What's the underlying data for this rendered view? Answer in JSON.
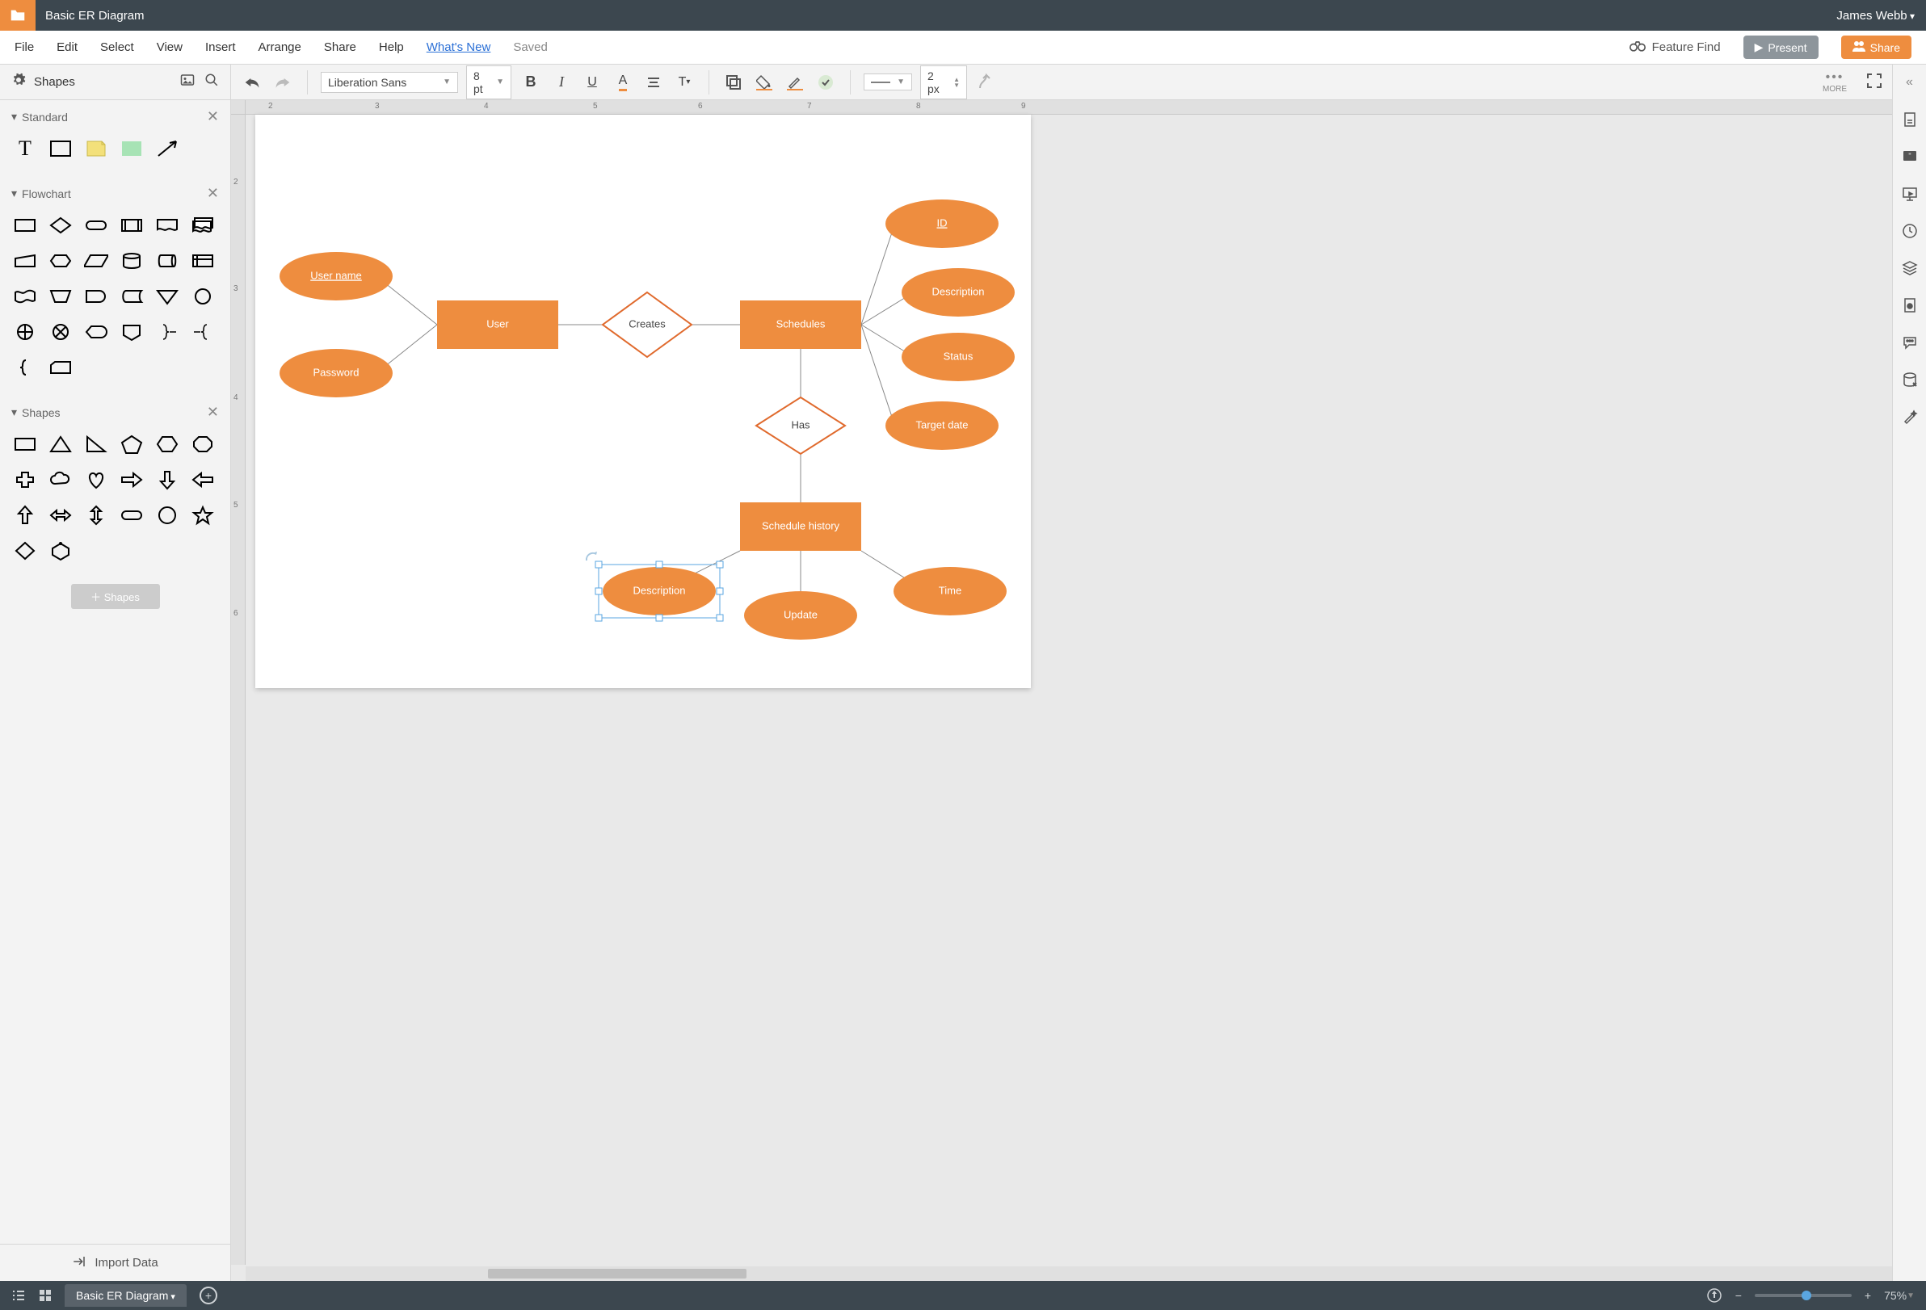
{
  "title": "Basic ER Diagram",
  "user": "James Webb",
  "menu": {
    "items": [
      "File",
      "Edit",
      "Select",
      "View",
      "Insert",
      "Arrange",
      "Share",
      "Help"
    ],
    "whats_new": "What's New",
    "saved": "Saved",
    "feature_find": "Feature Find",
    "present": "Present",
    "share": "Share"
  },
  "left": {
    "shapes_label": "Shapes",
    "sections": [
      "Standard",
      "Flowchart",
      "Shapes"
    ],
    "add_shapes": "Shapes",
    "import": "Import Data"
  },
  "toolbar": {
    "font": "Liberation Sans",
    "font_size": "8 pt",
    "line_width": "2 px",
    "more": "MORE"
  },
  "ruler_h": [
    "2",
    "3",
    "4",
    "5",
    "6",
    "7",
    "8",
    "9"
  ],
  "ruler_v": [
    "2",
    "3",
    "4",
    "5",
    "6"
  ],
  "er": {
    "username": "User name",
    "password": "Password",
    "user": "User",
    "creates": "Creates",
    "schedules": "Schedules",
    "id": "ID",
    "description": "Description",
    "status": "Status",
    "target_date": "Target date",
    "has": "Has",
    "schedule_history": "Schedule history",
    "sh_description": "Description",
    "update": "Update",
    "time": "Time"
  },
  "bottom": {
    "tab": "Basic ER Diagram",
    "zoom": "75%"
  }
}
